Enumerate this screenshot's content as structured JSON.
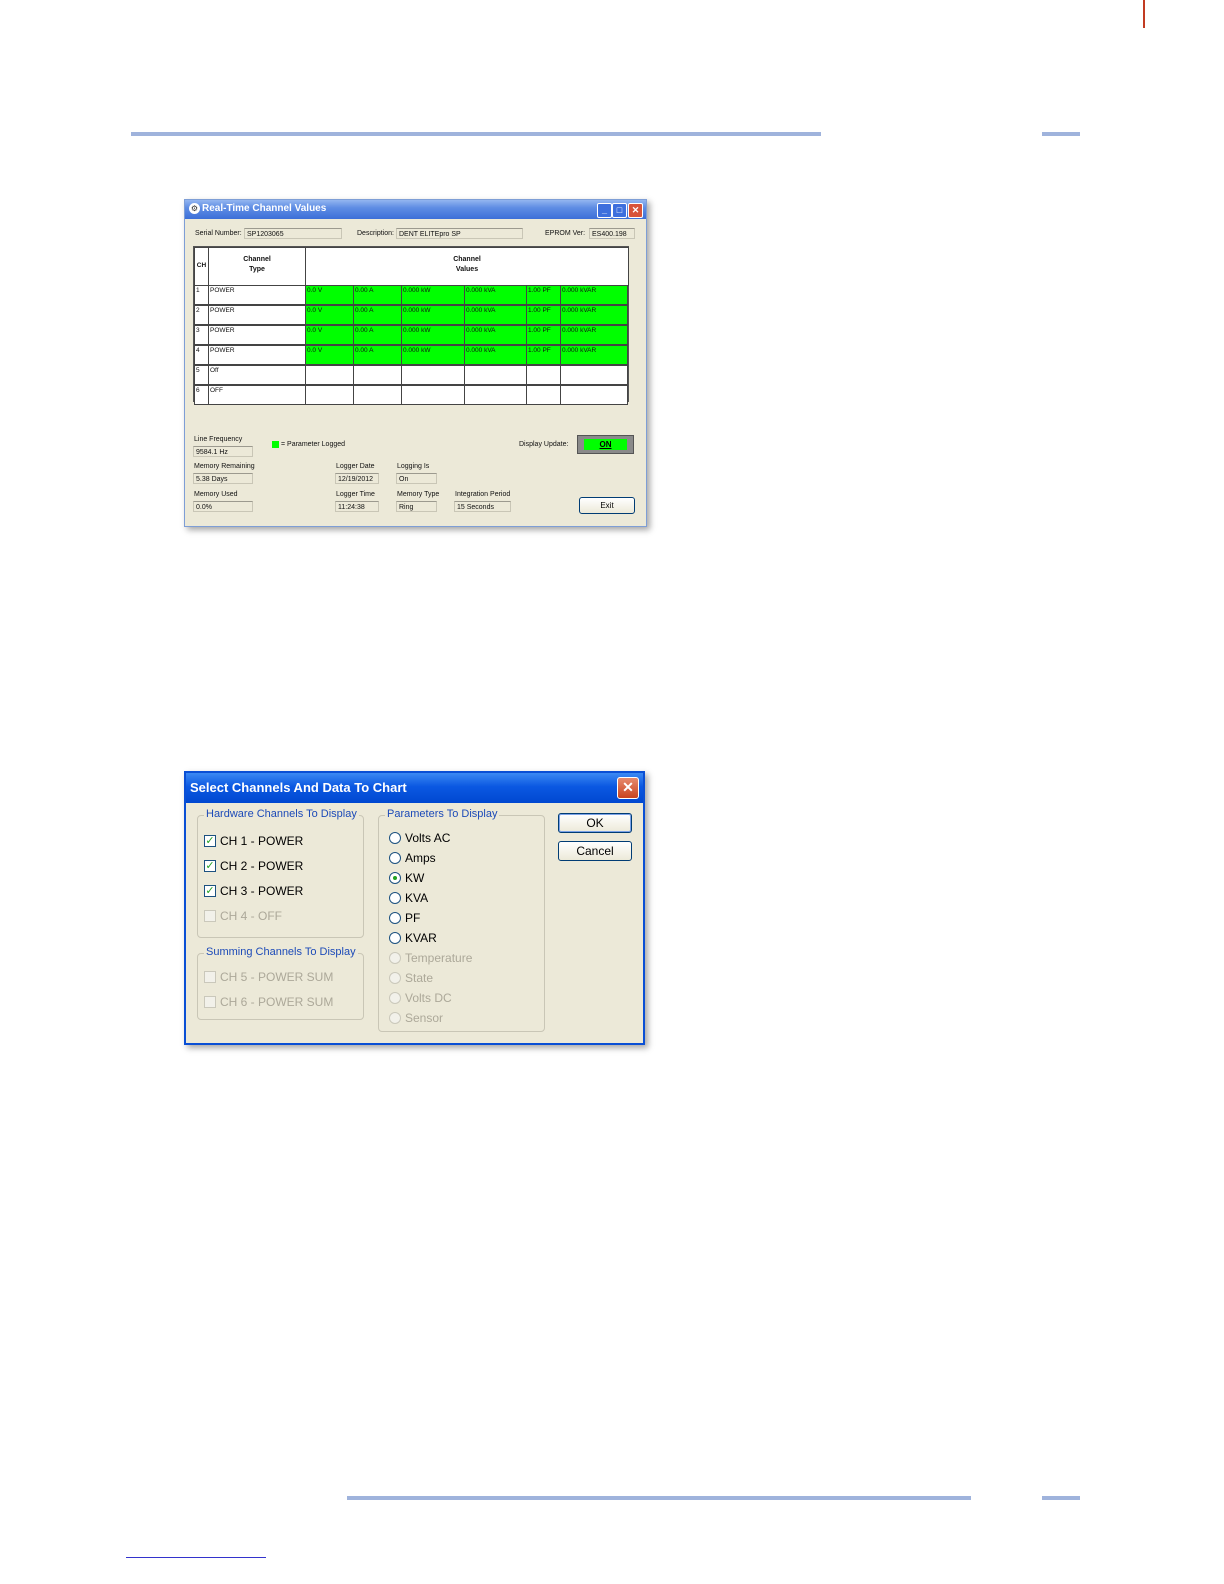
{
  "window1": {
    "title": "Real-Time Channel Values",
    "serial_label": "Serial Number:",
    "serial_value": "SP1203065",
    "description_label": "Description:",
    "description_value": "DENT ELITEpro SP",
    "eprom_label": "EPROM Ver:",
    "eprom_value": "ES400.198",
    "col_ch": "CH",
    "col_type_1": "Channel",
    "col_type_2": "Type",
    "col_values_1": "Channel",
    "col_values_2": "Values",
    "rows": [
      {
        "ch": "1",
        "type": "POWER",
        "values": [
          "0.0 V",
          "0.00 A",
          "0.000 kW",
          "0.000 kVA",
          "1.00 PF",
          "0.000 kVAR"
        ],
        "logged": true
      },
      {
        "ch": "2",
        "type": "POWER",
        "values": [
          "0.0 V",
          "0.00 A",
          "0.000 kW",
          "0.000 kVA",
          "1.00 PF",
          "0.000 kVAR"
        ],
        "logged": true
      },
      {
        "ch": "3",
        "type": "POWER",
        "values": [
          "0.0 V",
          "0.00 A",
          "0.000 kW",
          "0.000 kVA",
          "1.00 PF",
          "0.000 kVAR"
        ],
        "logged": true
      },
      {
        "ch": "4",
        "type": "POWER",
        "values": [
          "0.0 V",
          "0.00 A",
          "0.000 kW",
          "0.000 kVA",
          "1.00 PF",
          "0.000 kVAR"
        ],
        "logged": true
      },
      {
        "ch": "5",
        "type": "Off",
        "values": [
          "",
          "",
          "",
          "",
          "",
          ""
        ],
        "logged": false
      },
      {
        "ch": "6",
        "type": "OFF",
        "values": [
          "",
          "",
          "",
          "",
          "",
          ""
        ],
        "logged": false
      }
    ],
    "line_freq_label": "Line Frequency",
    "line_freq_value": "9584.1 Hz",
    "legend_text": "= Parameter Logged",
    "legend_color": "#00ff00",
    "display_update_label": "Display Update:",
    "display_update_value": "ON",
    "memory_remaining_label": "Memory Remaining",
    "memory_remaining_value": "5.38 Days",
    "memory_used_label": "Memory Used",
    "memory_used_value": "0.0%",
    "logger_date_label": "Logger Date",
    "logger_date_value": "12/19/2012",
    "logger_time_label": "Logger Time",
    "logger_time_value": "11:24:38",
    "logging_is_label": "Logging Is",
    "logging_is_value": "On",
    "memory_type_label": "Memory Type",
    "memory_type_value": "Ring",
    "integration_label": "Integration Period",
    "integration_value": "15 Seconds",
    "exit_label": "Exit"
  },
  "window2": {
    "title": "Select Channels And Data To Chart",
    "hardware_group": "Hardware Channels To Display",
    "hardware_channels": [
      {
        "label": "CH 1 - POWER",
        "checked": true,
        "enabled": true
      },
      {
        "label": "CH 2 - POWER",
        "checked": true,
        "enabled": true
      },
      {
        "label": "CH 3 - POWER",
        "checked": true,
        "enabled": true
      },
      {
        "label": "CH 4 - OFF",
        "checked": false,
        "enabled": false
      }
    ],
    "summing_group": "Summing Channels To Display",
    "summing_channels": [
      {
        "label": "CH 5 - POWER SUM",
        "checked": false,
        "enabled": false
      },
      {
        "label": "CH 6 - POWER SUM",
        "checked": false,
        "enabled": false
      }
    ],
    "parameters_group": "Parameters To Display",
    "parameters": [
      {
        "label": "Volts AC",
        "selected": false,
        "enabled": true
      },
      {
        "label": "Amps",
        "selected": false,
        "enabled": true
      },
      {
        "label": "KW",
        "selected": true,
        "enabled": true
      },
      {
        "label": "KVA",
        "selected": false,
        "enabled": true
      },
      {
        "label": "PF",
        "selected": false,
        "enabled": true
      },
      {
        "label": "KVAR",
        "selected": false,
        "enabled": true
      },
      {
        "label": "Temperature",
        "selected": false,
        "enabled": false
      },
      {
        "label": "State",
        "selected": false,
        "enabled": false
      },
      {
        "label": "Volts DC",
        "selected": false,
        "enabled": false
      },
      {
        "label": "Sensor",
        "selected": false,
        "enabled": false
      }
    ],
    "ok_label": "OK",
    "cancel_label": "Cancel"
  }
}
